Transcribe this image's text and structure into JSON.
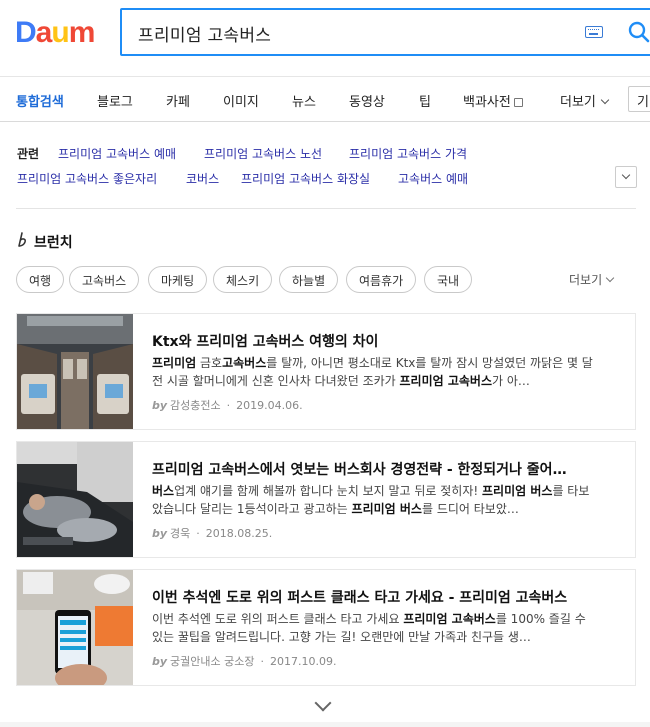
{
  "logo": {
    "letters": [
      "D",
      "a",
      "u",
      "m"
    ],
    "colors": [
      "#3e7bf6",
      "#ef4836",
      "#ffc316",
      "#ef4836"
    ]
  },
  "search": {
    "query": "프리미엄 고속버스"
  },
  "nav": {
    "items": [
      "통합검색",
      "블로그",
      "카페",
      "이미지",
      "뉴스",
      "동영상",
      "팁",
      "백과사전",
      "더보기"
    ],
    "select_value": "기"
  },
  "related": {
    "label": "관련",
    "links": [
      "프리미엄 고속버스 예매",
      "프리미엄 고속버스 노선",
      "프리미엄 고속버스 가격",
      "프리미엄 고속버스 좋은자리",
      "코버스",
      "프리미엄 고속버스 화장실",
      "고속버스 예매"
    ]
  },
  "brunch": {
    "title": "브런치",
    "chips": [
      "여행",
      "고속버스",
      "마케팅",
      "체스키",
      "하늘별",
      "여름휴가",
      "국내"
    ],
    "more": "더보기"
  },
  "articles": [
    {
      "title": "Ktx와 프리미엄 고속버스 여행의 차이",
      "desc_html": "<b>프리미엄</b> 금호<b>고속버스</b>를 탈까, 아니면 평소대로 Ktx를 탈까 잠시 망설였던 까닭은 몇 달 전 시골 할머니에게 신혼 인사차 다녀왔던 조카가 <b>프리미엄 고속버스</b>가 아…",
      "by": "by",
      "author": "감성충전소",
      "date": "2019.04.06."
    },
    {
      "title": "프리미엄 고속버스에서 엿보는 버스회사 경영전략 - 한정되거나 줄어…",
      "desc_html": "<b>버스</b>업계 얘기를 함께 해볼까 합니다 눈치 보지 말고 뒤로 젖히자! <b>프리미엄 버스</b>를 타보았습니다 달리는 1등석이라고 광고하는 <b>프리미엄 버스</b>를 드디어 타보았…",
      "by": "by",
      "author": "경욱",
      "date": "2018.08.25."
    },
    {
      "title": "이번 추석엔 도로 위의 퍼스트 클래스 타고 가세요 - 프리미엄 고속버스",
      "desc_html": "이번 추석엔 도로 위의 퍼스트 클래스 타고 가세요 <b>프리미엄 고속버스</b>를 100% 즐길 수 있는 꿀팁을 알려드립니다. 고향 가는 길! 오랜만에 만날 가족과 친구들 생…",
      "by": "by",
      "author": "궁궐안내소 궁소장",
      "date": "2017.10.09."
    }
  ],
  "colors": {
    "accent": "#1f8df6",
    "active_tab": "#1f6cd8",
    "link": "#2b2fa8"
  }
}
